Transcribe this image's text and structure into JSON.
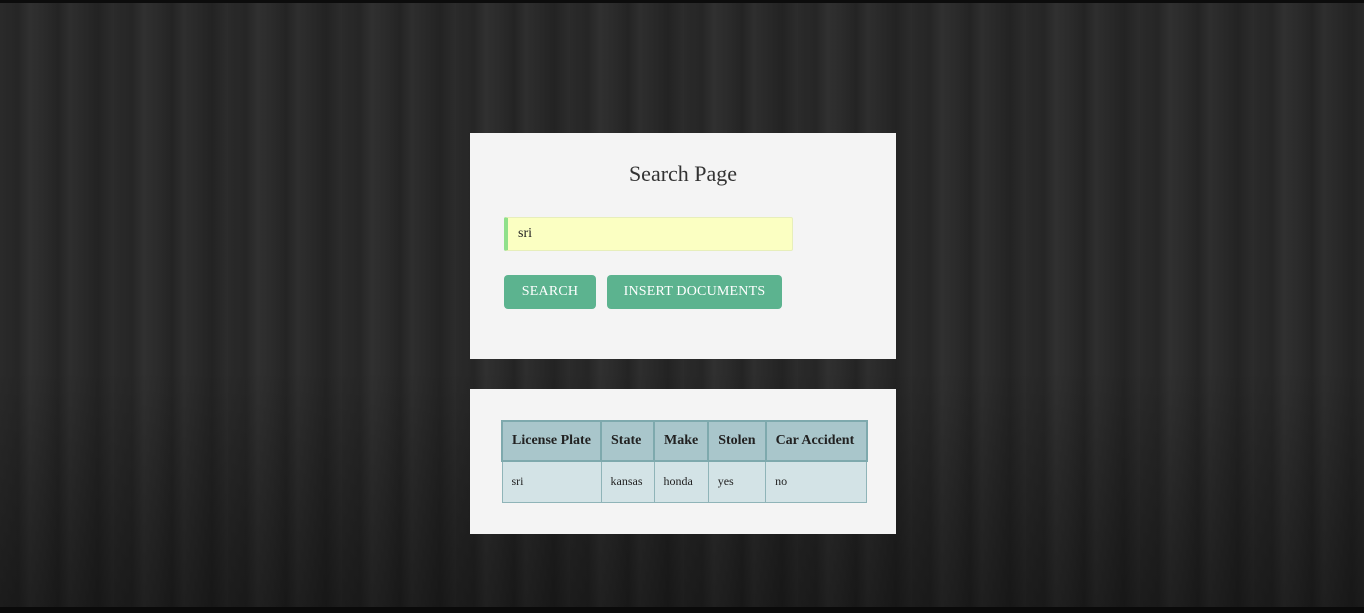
{
  "search": {
    "title": "Search Page",
    "input_value": "sri",
    "search_label": "SEARCH",
    "insert_label": "INSERT DOCUMENTS"
  },
  "results": {
    "columns": [
      "License Plate",
      "State",
      "Make",
      "Stolen",
      "Car Accident"
    ],
    "rows": [
      [
        "sri",
        "kansas",
        "honda",
        "yes",
        "no"
      ]
    ]
  },
  "colors": {
    "button": "#5cb38f",
    "input_background": "#fbffc2",
    "input_accent": "#8fe08a",
    "table_header": "#a9c6cb",
    "table_cell": "#d3e3e6",
    "panel": "#f4f4f4"
  }
}
